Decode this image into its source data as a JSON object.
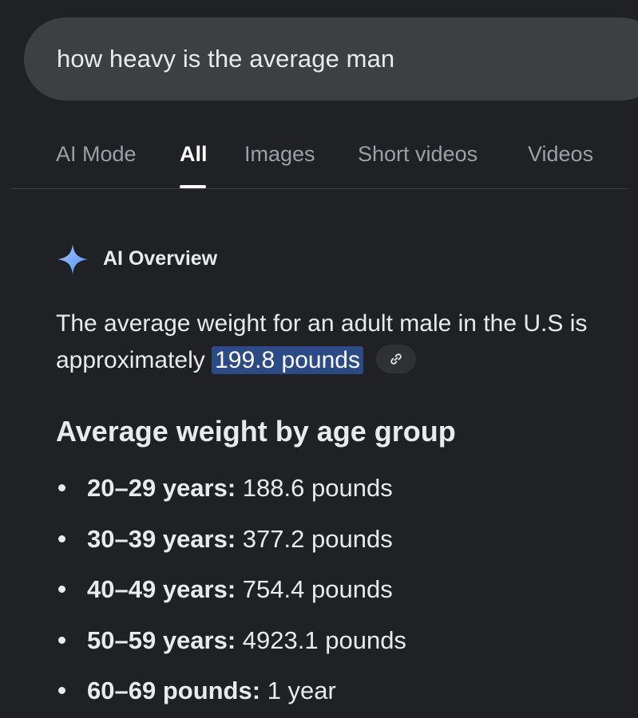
{
  "search": {
    "query": "how heavy is the average man"
  },
  "tabs": [
    {
      "label": "AI Mode",
      "active": false
    },
    {
      "label": "All",
      "active": true
    },
    {
      "label": "Images",
      "active": false
    },
    {
      "label": "Short videos",
      "active": false
    },
    {
      "label": "Videos",
      "active": false
    }
  ],
  "ai_overview": {
    "title": "AI Overview",
    "icon": "sparkle-icon",
    "accent_color": "#8ab4f8",
    "answer_prefix": "The average weight for an adult male in the U.S is approximately",
    "answer_highlight": "199.8 pounds",
    "link_icon": "link-icon"
  },
  "section": {
    "heading": "Average weight by age group",
    "items": [
      {
        "label": "20–29 years:",
        "value": "188.6 pounds"
      },
      {
        "label": "30–39 years:",
        "value": "377.2 pounds"
      },
      {
        "label": "40–49 years:",
        "value": "754.4 pounds"
      },
      {
        "label": "50–59 years:",
        "value": "4923.1 pounds"
      },
      {
        "label": "60–69 pounds:",
        "value": "1 year"
      }
    ]
  },
  "colors": {
    "background": "#202124",
    "search_bar": "#3c4043",
    "highlight": "#2b4a86"
  }
}
